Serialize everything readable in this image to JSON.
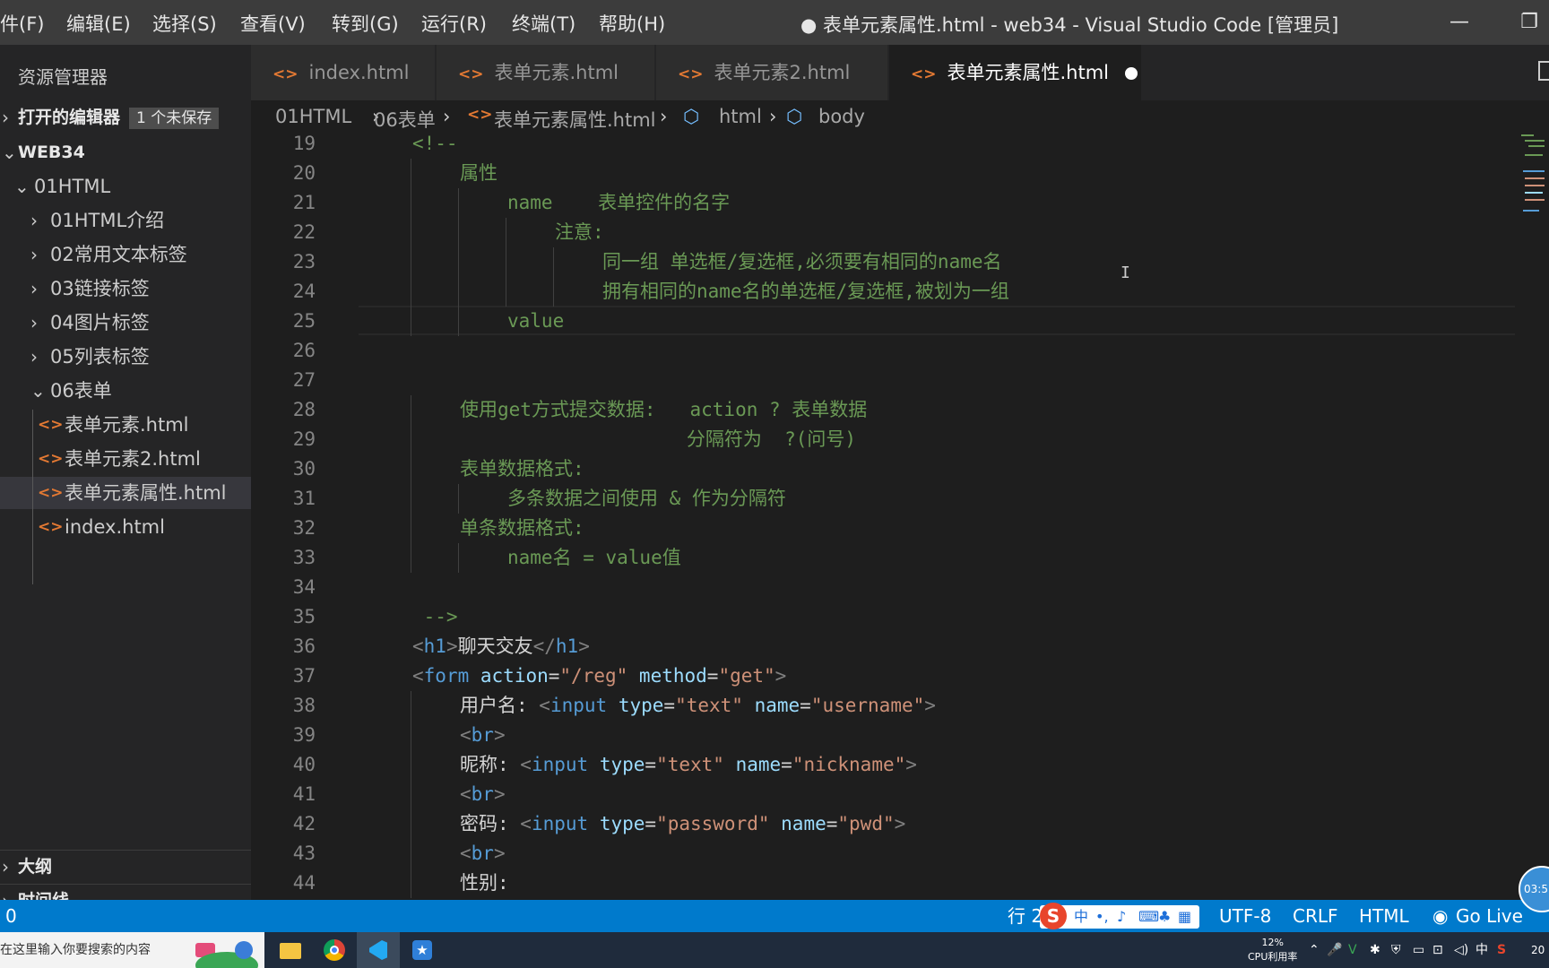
{
  "menu": [
    "件(F)",
    "编辑(E)",
    "选择(S)",
    "查看(V)",
    "转到(G)",
    "运行(R)",
    "终端(T)",
    "帮助(H)"
  ],
  "window_title": "● 表单元素属性.html - web34 - Visual Studio Code [管理员]",
  "window_controls": {
    "minimize": "—",
    "restore": "❐"
  },
  "sidebar": {
    "title": "资源管理器",
    "open_editors": {
      "label": "打开的编辑器",
      "badge": "1 个未保存"
    },
    "workspace": "WEB34",
    "tree": [
      {
        "label": "01HTML",
        "kind": "folder-open"
      },
      {
        "label": "01HTML介绍",
        "kind": "folder"
      },
      {
        "label": "02常用文本标签",
        "kind": "folder"
      },
      {
        "label": "03链接标签",
        "kind": "folder"
      },
      {
        "label": "04图片标签",
        "kind": "folder"
      },
      {
        "label": "05列表标签",
        "kind": "folder"
      },
      {
        "label": "06表单",
        "kind": "folder-open"
      },
      {
        "label": "表单元素.html",
        "kind": "file"
      },
      {
        "label": "表单元素2.html",
        "kind": "file"
      },
      {
        "label": "表单元素属性.html",
        "kind": "file",
        "selected": true
      },
      {
        "label": "index.html",
        "kind": "file"
      }
    ],
    "outline": "大纲",
    "timeline": "时间线"
  },
  "tabs": [
    {
      "label": "index.html",
      "active": false
    },
    {
      "label": "表单元素.html",
      "active": false
    },
    {
      "label": "表单元素2.html",
      "active": false
    },
    {
      "label": "表单元素属性.html",
      "active": true,
      "dirty": true
    }
  ],
  "file_icon_glyph": "<>",
  "breadcrumb": [
    "01HTML",
    "06表单",
    "表单元素属性.html",
    "html",
    "body"
  ],
  "editor": {
    "lines": [
      {
        "n": "19",
        "indent": 0,
        "tokens": [
          [
            "c-com",
            "<!--"
          ]
        ]
      },
      {
        "n": "20",
        "indent": 1,
        "tokens": [
          [
            "c-com",
            "属性"
          ]
        ]
      },
      {
        "n": "21",
        "indent": 2,
        "tokens": [
          [
            "c-com",
            "name    表单控件的名字"
          ]
        ]
      },
      {
        "n": "22",
        "indent": 3,
        "tokens": [
          [
            "c-com",
            "注意:"
          ]
        ]
      },
      {
        "n": "23",
        "indent": 4,
        "tokens": [
          [
            "c-com",
            "同一组 单选框/复选框,必须要有相同的name名"
          ]
        ]
      },
      {
        "n": "24",
        "indent": 4,
        "tokens": [
          [
            "c-com",
            "拥有相同的name名的单选框/复选框,被划为一组"
          ]
        ]
      },
      {
        "n": "25",
        "indent": 2,
        "tokens": [
          [
            "c-com",
            "value"
          ]
        ]
      },
      {
        "n": "26",
        "indent": 0,
        "tokens": []
      },
      {
        "n": "27",
        "indent": 0,
        "tokens": []
      },
      {
        "n": "28",
        "indent": 1,
        "tokens": [
          [
            "c-com",
            "使用get方式提交数据:   action ? 表单数据"
          ]
        ]
      },
      {
        "n": "29",
        "indent": 1,
        "tokens": [
          [
            "c-com",
            "                    分隔符为  ?(问号)"
          ]
        ]
      },
      {
        "n": "30",
        "indent": 1,
        "tokens": [
          [
            "c-com",
            "表单数据格式:"
          ]
        ]
      },
      {
        "n": "31",
        "indent": 2,
        "tokens": [
          [
            "c-com",
            "多条数据之间使用 & 作为分隔符"
          ]
        ]
      },
      {
        "n": "32",
        "indent": 1,
        "tokens": [
          [
            "c-com",
            "单条数据格式:"
          ]
        ]
      },
      {
        "n": "33",
        "indent": 2,
        "tokens": [
          [
            "c-com",
            "name名 = value值"
          ]
        ]
      },
      {
        "n": "34",
        "indent": 0,
        "tokens": []
      },
      {
        "n": "35",
        "indent": 0,
        "tokens": [
          [
            "c-com",
            " -->"
          ]
        ]
      },
      {
        "n": "36",
        "indent": 0,
        "tokens": [
          [
            "c-br",
            "<"
          ],
          [
            "c-tag",
            "h1"
          ],
          [
            "c-br",
            ">"
          ],
          [
            "c-txt",
            "聊天交友"
          ],
          [
            "c-br",
            "</"
          ],
          [
            "c-tag",
            "h1"
          ],
          [
            "c-br",
            ">"
          ]
        ]
      },
      {
        "n": "37",
        "indent": 0,
        "tokens": [
          [
            "c-br",
            "<"
          ],
          [
            "c-tag",
            "form"
          ],
          [
            "c-txt",
            " "
          ],
          [
            "c-attr",
            "action"
          ],
          [
            "c-txt",
            "="
          ],
          [
            "c-str",
            "\"/reg\""
          ],
          [
            "c-txt",
            " "
          ],
          [
            "c-attr",
            "method"
          ],
          [
            "c-txt",
            "="
          ],
          [
            "c-str",
            "\"get\""
          ],
          [
            "c-br",
            ">"
          ]
        ]
      },
      {
        "n": "38",
        "indent": 1,
        "tokens": [
          [
            "c-txt",
            "用户名: "
          ],
          [
            "c-br",
            "<"
          ],
          [
            "c-tag",
            "input"
          ],
          [
            "c-txt",
            " "
          ],
          [
            "c-attr",
            "type"
          ],
          [
            "c-txt",
            "="
          ],
          [
            "c-str",
            "\"text\""
          ],
          [
            "c-txt",
            " "
          ],
          [
            "c-attr",
            "name"
          ],
          [
            "c-txt",
            "="
          ],
          [
            "c-str",
            "\"username\""
          ],
          [
            "c-br",
            ">"
          ]
        ]
      },
      {
        "n": "39",
        "indent": 1,
        "tokens": [
          [
            "c-br",
            "<"
          ],
          [
            "c-tag",
            "br"
          ],
          [
            "c-br",
            ">"
          ]
        ]
      },
      {
        "n": "40",
        "indent": 1,
        "tokens": [
          [
            "c-txt",
            "昵称: "
          ],
          [
            "c-br",
            "<"
          ],
          [
            "c-tag",
            "input"
          ],
          [
            "c-txt",
            " "
          ],
          [
            "c-attr",
            "type"
          ],
          [
            "c-txt",
            "="
          ],
          [
            "c-str",
            "\"text\""
          ],
          [
            "c-txt",
            " "
          ],
          [
            "c-attr",
            "name"
          ],
          [
            "c-txt",
            "="
          ],
          [
            "c-str",
            "\"nickname\""
          ],
          [
            "c-br",
            ">"
          ]
        ]
      },
      {
        "n": "41",
        "indent": 1,
        "tokens": [
          [
            "c-br",
            "<"
          ],
          [
            "c-tag",
            "br"
          ],
          [
            "c-br",
            ">"
          ]
        ]
      },
      {
        "n": "42",
        "indent": 1,
        "tokens": [
          [
            "c-txt",
            "密码: "
          ],
          [
            "c-br",
            "<"
          ],
          [
            "c-tag",
            "input"
          ],
          [
            "c-txt",
            " "
          ],
          [
            "c-attr",
            "type"
          ],
          [
            "c-txt",
            "="
          ],
          [
            "c-str",
            "\"password\""
          ],
          [
            "c-txt",
            " "
          ],
          [
            "c-attr",
            "name"
          ],
          [
            "c-txt",
            "="
          ],
          [
            "c-str",
            "\"pwd\""
          ],
          [
            "c-br",
            ">"
          ]
        ]
      },
      {
        "n": "43",
        "indent": 1,
        "tokens": [
          [
            "c-br",
            "<"
          ],
          [
            "c-tag",
            "br"
          ],
          [
            "c-br",
            ">"
          ]
        ]
      },
      {
        "n": "44",
        "indent": 1,
        "tokens": [
          [
            "c-txt",
            "性别:"
          ]
        ]
      }
    ]
  },
  "status": {
    "left": "0",
    "position": "行 2",
    "encoding": "UTF-8",
    "eol": "CRLF",
    "language": "HTML",
    "golive": "Go Live",
    "ime": {
      "logo": "S",
      "mode": "中"
    },
    "clock": "03:5"
  },
  "taskbar": {
    "search_placeholder": "在这里输入你要搜索的内容",
    "cpu": "12%",
    "cpu_label": "CPU利用率",
    "ime": "中",
    "date": "20"
  }
}
